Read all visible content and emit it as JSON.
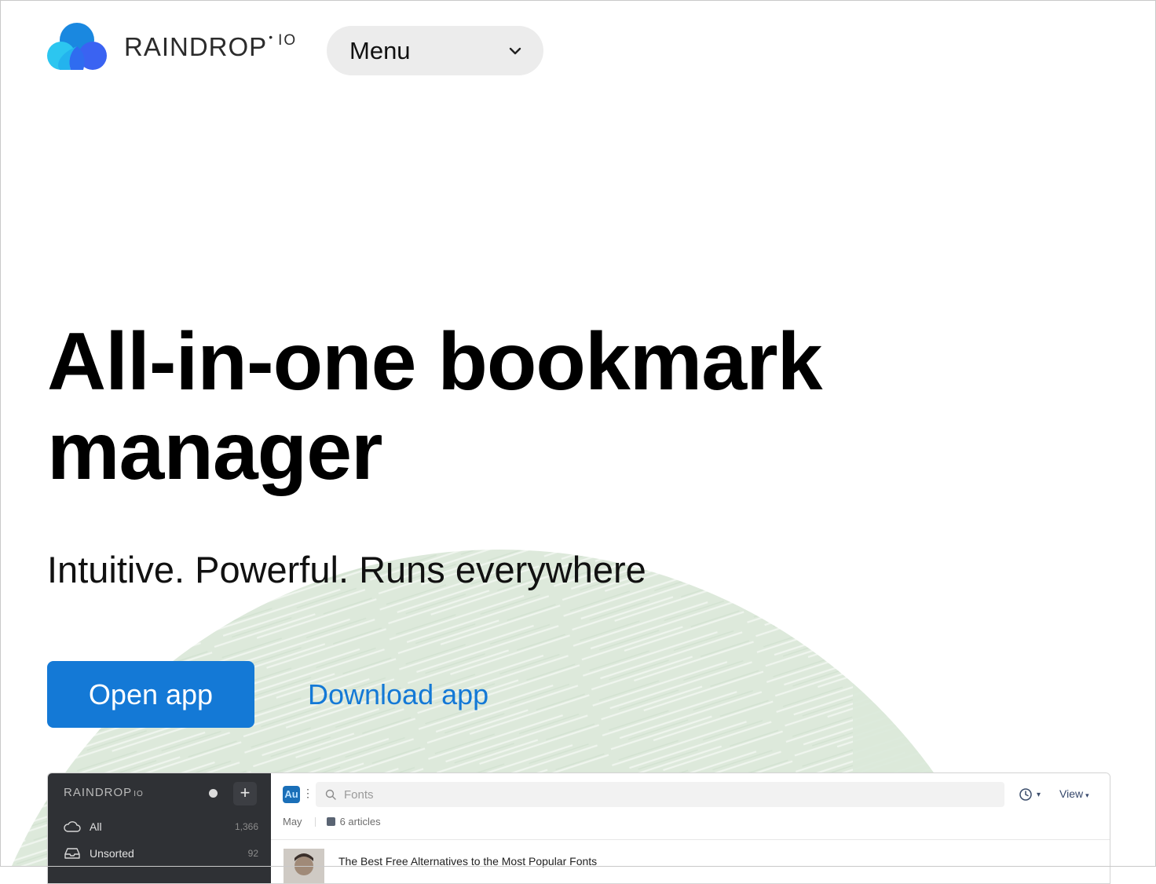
{
  "colors": {
    "accent": "#1479d6",
    "menu_bg": "#ececec",
    "arc_green": "#dbe9da",
    "app_sidebar": "#2f3135"
  },
  "header": {
    "logo": {
      "word": "RAINDROP",
      "dot": "•",
      "suffix": "IO",
      "icon": "raindrop-cloud-logo"
    },
    "menu": {
      "label": "Menu",
      "icon": "chevron-down-icon"
    }
  },
  "hero": {
    "title": "All-in-one bookmark manager",
    "subtitle": "Intuitive. Powerful. Runs everywhere",
    "open_button": "Open app",
    "download_link": "Download app"
  },
  "app_preview": {
    "sidebar": {
      "brand": "RAINDROP",
      "brand_suffix": "IO",
      "add": "+",
      "items": [
        {
          "label": "All",
          "count": "1,366",
          "icon": "cloud-icon"
        },
        {
          "label": "Unsorted",
          "count": "92",
          "icon": "inbox-icon"
        }
      ]
    },
    "toolbar": {
      "collection_badge": "Au",
      "search_placeholder": "Fonts",
      "view_label": "View"
    },
    "subheader": {
      "date": "May",
      "articles": "6 articles"
    },
    "rows": [
      {
        "title": "The Best Free Alternatives to the Most Popular Fonts"
      }
    ]
  }
}
